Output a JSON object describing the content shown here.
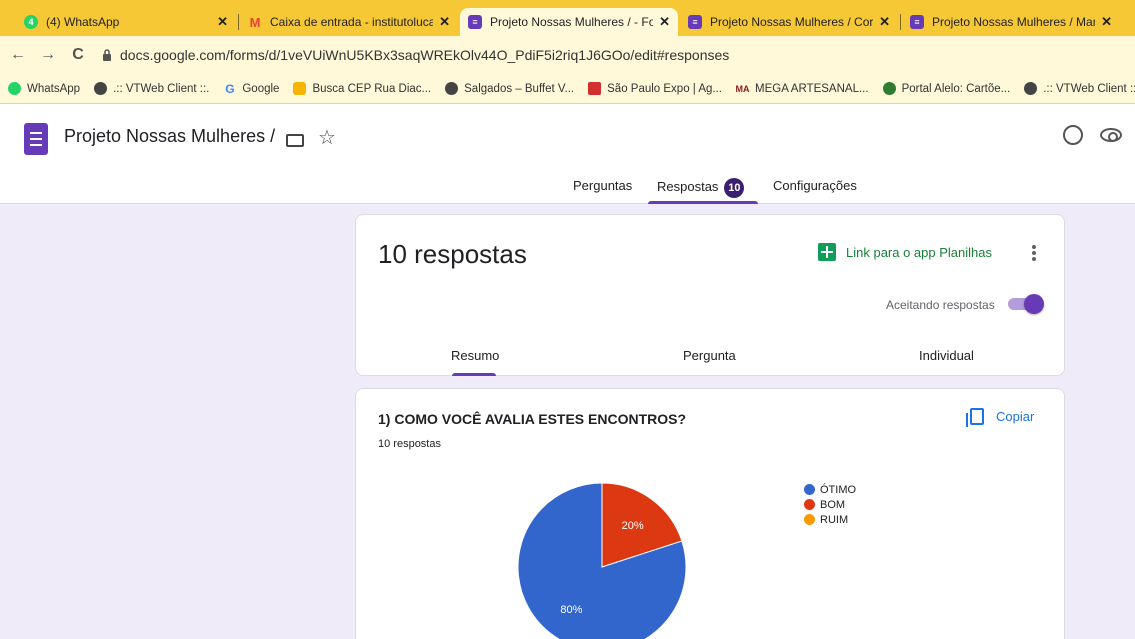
{
  "browser": {
    "tabs": [
      {
        "title": "(4) WhatsApp",
        "icon": "whatsapp-icon",
        "color": "#25d366",
        "glyph": "4"
      },
      {
        "title": "Caixa de entrada - institutolucas",
        "icon": "gmail-icon",
        "color": "#ea4335",
        "glyph": "M"
      },
      {
        "title": "Projeto Nossas Mulheres / - Form",
        "icon": "forms-icon",
        "color": "#673ab7",
        "glyph": "≡"
      },
      {
        "title": "Projeto Nossas Mulheres / Corte",
        "icon": "forms-icon",
        "color": "#673ab7",
        "glyph": "≡"
      },
      {
        "title": "Projeto Nossas Mulheres / Manic",
        "icon": "forms-icon",
        "color": "#673ab7",
        "glyph": "≡"
      }
    ],
    "url": "docs.google.com/forms/d/1veVUiWnU5KBx3saqWREkOlv44O_PdiF5i2riq1J6GOo/edit#responses",
    "bookmarks": [
      {
        "label": "WhatsApp",
        "icon": "whatsapp-icon",
        "color": "#25d366"
      },
      {
        "label": ".:: VTWeb Client ::.",
        "icon": "globe-icon",
        "color": "#444444"
      },
      {
        "label": "Google",
        "icon": "google-icon",
        "color": "#4285f4"
      },
      {
        "label": "Busca CEP Rua Diac...",
        "icon": "cep-icon",
        "color": "#f4b400"
      },
      {
        "label": "Salgados – Buffet V...",
        "icon": "globe-icon",
        "color": "#444444"
      },
      {
        "label": "São Paulo Expo | Ag...",
        "icon": "expo-icon",
        "color": "#d32f2f"
      },
      {
        "label": "MEGA ARTESANAL...",
        "icon": "mega-icon",
        "color": "#8b1a1a"
      },
      {
        "label": "Portal Alelo: Cartõe...",
        "icon": "alelo-icon",
        "color": "#2e7d32"
      },
      {
        "label": ".:: VTWeb Client ::.",
        "icon": "globe-icon",
        "color": "#444444"
      }
    ]
  },
  "form": {
    "title": "Projeto Nossas Mulheres /",
    "tabs": {
      "perguntas": "Perguntas",
      "respostas": "Respostas",
      "respostas_badge": "10",
      "configuracoes": "Configurações"
    }
  },
  "summary": {
    "count_label": "10 respostas",
    "sheets_link": "Link para o app Planilhas",
    "accepting_label": "Aceitando respostas",
    "accepting": true,
    "subtabs": {
      "resumo": "Resumo",
      "pergunta": "Pergunta",
      "individual": "Individual"
    }
  },
  "question": {
    "title": "1) COMO VOCÊ AVALIA ESTES ENCONTROS?",
    "responses": "10 respostas",
    "copy_label": "Copiar"
  },
  "chart_data": {
    "type": "pie",
    "categories": [
      "ÓTIMO",
      "BOM",
      "RUIM"
    ],
    "values": [
      80,
      20,
      0
    ],
    "value_labels": [
      "80%",
      "20%",
      ""
    ],
    "colors": [
      "#3366cc",
      "#dc3912",
      "#ff9900"
    ],
    "legend": "right"
  },
  "colors": {
    "accent": "#673ab7",
    "sheets_green": "#188038",
    "link_blue": "#1a73e8",
    "chrome_tab": "#f6c836"
  }
}
